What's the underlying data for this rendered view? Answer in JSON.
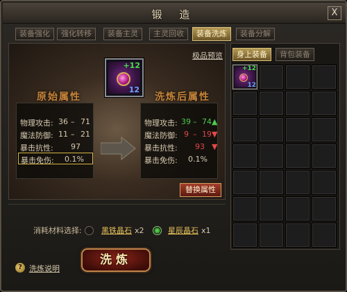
{
  "window": {
    "title": "锻 造",
    "close_label": "X"
  },
  "tabs": [
    {
      "label": "装备强化",
      "active": false
    },
    {
      "label": "强化转移",
      "active": false
    },
    {
      "label": "装备主灵",
      "active": false
    },
    {
      "label": "主灵回收",
      "active": false
    },
    {
      "label": "装备洗炼",
      "active": true
    },
    {
      "label": "装备分解",
      "active": false
    }
  ],
  "preview_link": "极品预览",
  "item": {
    "plus": "+12",
    "level": "12",
    "icon": "dragon-gem-icon"
  },
  "original": {
    "heading": "原始属性",
    "rows": [
      {
        "label": "物理攻击:",
        "min": "36",
        "sep": "–",
        "max": "71"
      },
      {
        "label": "魔法防御:",
        "min": "11",
        "sep": "–",
        "max": "21"
      },
      {
        "label": "暴击抗性:",
        "value": "97"
      },
      {
        "label": "暴击免伤:",
        "value": "0.1%"
      }
    ]
  },
  "refined": {
    "heading": "洗炼后属性",
    "rows": [
      {
        "label": "物理攻击:",
        "min": "39",
        "sep": "–",
        "max": "74",
        "trend": "up"
      },
      {
        "label": "魔法防御:",
        "min": "9",
        "sep": "–",
        "max": "19",
        "trend": "down"
      },
      {
        "label": "暴击抗性:",
        "value": "93",
        "trend": "down"
      },
      {
        "label": "暴击免伤:",
        "value": "0.1%"
      }
    ]
  },
  "replace_button": "替换属性",
  "materials": {
    "label": "消耗材料选择:",
    "options": [
      {
        "name": "黑铁晶石",
        "qty": "x2",
        "selected": false
      },
      {
        "name": "星辰晶石",
        "qty": "x1",
        "selected": true
      }
    ]
  },
  "refine_button": "洗炼",
  "help": {
    "icon_glyph": "?",
    "text": "洗炼说明"
  },
  "inventory": {
    "tabs": [
      {
        "label": "身上装备",
        "active": true
      },
      {
        "label": "背包装备",
        "active": false
      }
    ],
    "first_item": {
      "plus": "+12",
      "level": "12"
    }
  },
  "colors": {
    "accent_gold": "#d8c07a",
    "stat_up": "#4ec84e",
    "stat_down": "#e24848",
    "heading_orange": "#c8853a"
  }
}
